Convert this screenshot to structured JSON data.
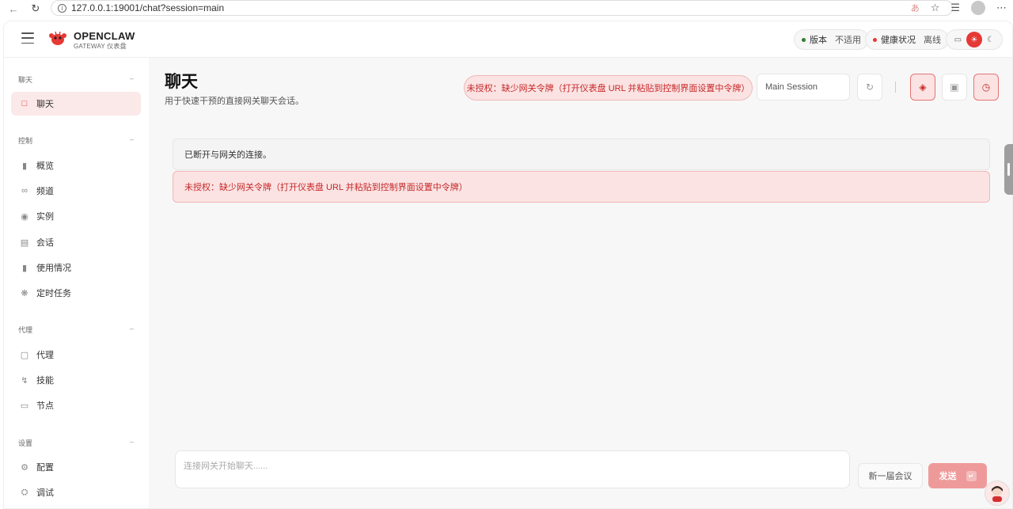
{
  "browser": {
    "url": "127.0.0.1:19001/chat?session=main",
    "back_icon": "arrow-left-icon",
    "reload_icon": "reload-icon"
  },
  "brand": {
    "name": "OPENCLAW",
    "subtitle": "GATEWAY 仪表盘",
    "accent_color": "#e53935"
  },
  "status": {
    "version_label": "版本",
    "version_value": "不适用",
    "version_color": "#2e7d32",
    "health_label": "健康状况",
    "health_value": "离线",
    "health_color": "#e53935"
  },
  "sidebar": {
    "sections": [
      {
        "title": "聊天",
        "items": [
          {
            "label": "聊天",
            "icon": "chat-bubble-icon",
            "active": true
          }
        ]
      },
      {
        "title": "控制",
        "items": [
          {
            "label": "概览",
            "icon": "bar-chart-icon"
          },
          {
            "label": "频道",
            "icon": "link-icon"
          },
          {
            "label": "实例",
            "icon": "radio-icon"
          },
          {
            "label": "会话",
            "icon": "document-icon"
          },
          {
            "label": "使用情况",
            "icon": "bar-chart-icon"
          },
          {
            "label": "定时任务",
            "icon": "loader-icon"
          }
        ]
      },
      {
        "title": "代理",
        "items": [
          {
            "label": "代理",
            "icon": "folder-icon"
          },
          {
            "label": "技能",
            "icon": "lightning-icon"
          },
          {
            "label": "节点",
            "icon": "monitor-icon"
          }
        ]
      },
      {
        "title": "设置",
        "items": [
          {
            "label": "配置",
            "icon": "gear-icon"
          },
          {
            "label": "调试",
            "icon": "bug-icon"
          }
        ]
      }
    ]
  },
  "main": {
    "title": "聊天",
    "subtitle": "用于快速干预的直接网关聊天会话。",
    "error_pill": "未授权：缺少网关令牌（打开仪表盘 URL 并粘贴到控制界面设置中令牌）",
    "session_select": "Main Session",
    "notices": {
      "info": "已断开与网关的连接。",
      "error": "未授权：缺少网关令牌（打开仪表盘 URL 并粘贴到控制界面设置中令牌）"
    },
    "composer_placeholder": "连接网关开始聊天......",
    "new_meeting_label": "新一届会议",
    "send_label": "发送"
  }
}
